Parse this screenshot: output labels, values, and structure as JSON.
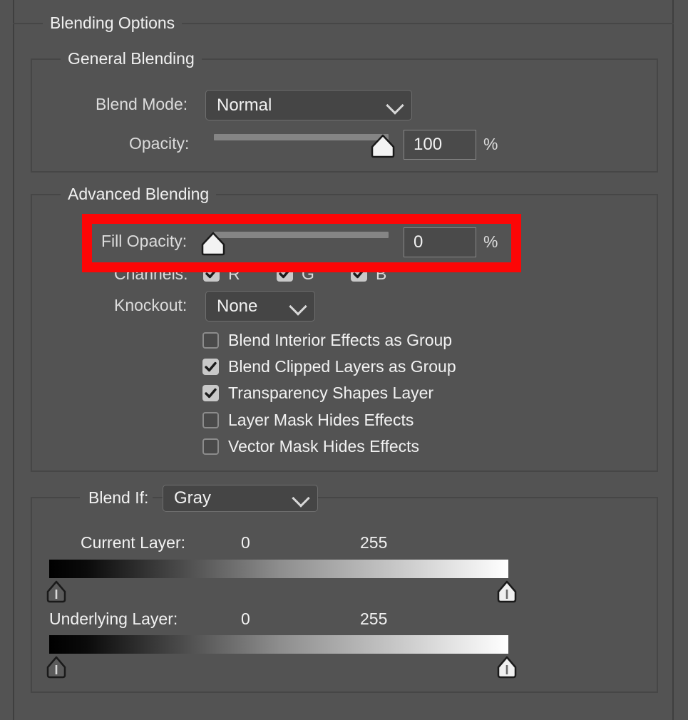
{
  "dialog": {
    "title": "Blending Options"
  },
  "general_blending": {
    "title": "General Blending",
    "blend_mode": {
      "label": "Blend Mode:",
      "value": "Normal"
    },
    "opacity": {
      "label": "Opacity:",
      "value": "100",
      "unit": "%",
      "percent": 100
    }
  },
  "advanced_blending": {
    "title": "Advanced Blending",
    "fill_opacity": {
      "label": "Fill Opacity:",
      "value": "0",
      "unit": "%",
      "percent": 0,
      "highlighted": true
    },
    "channels": {
      "label": "Channels:",
      "items": [
        {
          "label": "R",
          "checked": true
        },
        {
          "label": "G",
          "checked": true
        },
        {
          "label": "B",
          "checked": true
        }
      ]
    },
    "knockout": {
      "label": "Knockout:",
      "value": "None"
    },
    "options": [
      {
        "label": "Blend Interior Effects as Group",
        "checked": false
      },
      {
        "label": "Blend Clipped Layers as Group",
        "checked": true
      },
      {
        "label": "Transparency Shapes Layer",
        "checked": true
      },
      {
        "label": "Layer Mask Hides Effects",
        "checked": false
      },
      {
        "label": "Vector Mask Hides Effects",
        "checked": false
      }
    ]
  },
  "blend_if": {
    "label": "Blend If:",
    "channel": "Gray",
    "current_layer": {
      "label": "Current Layer:",
      "min": "0",
      "max": "255"
    },
    "underlying_layer": {
      "label": "Underlying Layer:",
      "min": "0",
      "max": "255"
    }
  },
  "colors": {
    "background": "#535353",
    "group_border": "#464646",
    "field_bg": "#454545",
    "field_border": "#6e6e6e",
    "slider_track": "#858585",
    "highlight": "#fc0606",
    "text": "#dcdcdc"
  }
}
